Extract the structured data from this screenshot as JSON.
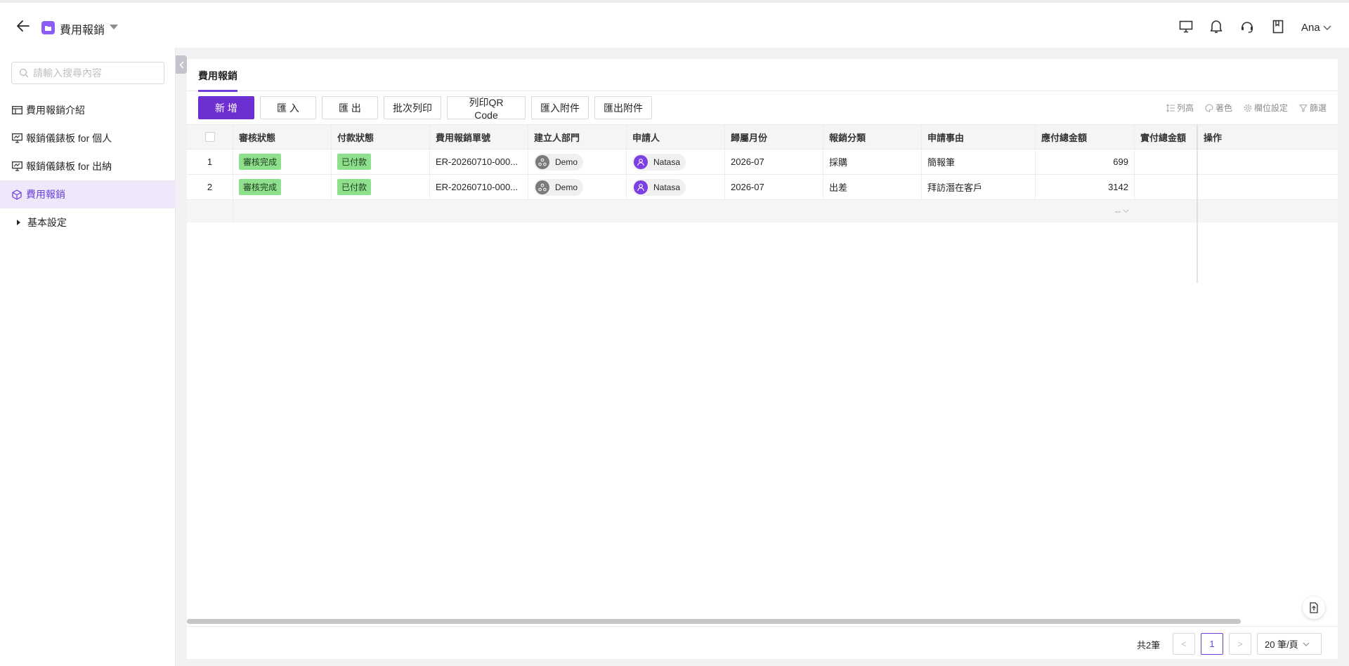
{
  "header": {
    "app_title": "費用報銷",
    "user_name": "Ana"
  },
  "icons": {
    "back": "arrow-left-icon",
    "app": "folder-icon",
    "monitor": "monitor-icon",
    "bell": "bell-icon",
    "headset": "headset-icon",
    "book": "book-icon"
  },
  "colors": {
    "accent": "#6d2fd1",
    "tag_green": "#8ee08c",
    "active_nav_bg": "#efe8fb"
  },
  "sidebar": {
    "search_placeholder": "請輸入搜尋內容",
    "items": [
      {
        "label": "費用報銷介紹",
        "icon": "table-icon"
      },
      {
        "label": "報銷儀錶板 for 個人",
        "icon": "dashboard-icon"
      },
      {
        "label": "報銷儀錶板 for 出納",
        "icon": "dashboard-icon"
      },
      {
        "label": "費用報銷",
        "icon": "cube-icon",
        "active": true
      },
      {
        "label": "基本設定",
        "icon": "caret-right-icon"
      }
    ]
  },
  "main": {
    "tab_label": "費用報銷",
    "toolbar": {
      "add": "新 增",
      "import": "匯 入",
      "export": "匯 出",
      "batch_print": "批次列印",
      "print_qr": "列印QR Code",
      "import_attach": "匯入附件",
      "export_attach": "匯出附件"
    },
    "tools": {
      "row_height": "列高",
      "coloring": "著色",
      "field_settings": "欄位設定",
      "filter": "篩選"
    },
    "table": {
      "columns": [
        "審核狀態",
        "付款狀態",
        "費用報銷單號",
        "建立人部門",
        "申請人",
        "歸屬月份",
        "報銷分類",
        "申請事由",
        "應付總金額",
        "實付總金額",
        "操作"
      ],
      "rows": [
        {
          "idx": "1",
          "review": "審核完成",
          "pay": "已付款",
          "no": "ER-20260710-000...",
          "dept": "Demo",
          "applicant": "Natasa",
          "month": "2026-07",
          "category": "採購",
          "reason": "簡報筆",
          "payable": "699",
          "paid": "",
          "op": ""
        },
        {
          "idx": "2",
          "review": "審核完成",
          "pay": "已付款",
          "no": "ER-20260710-000...",
          "dept": "Demo",
          "applicant": "Natasa",
          "month": "2026-07",
          "category": "出差",
          "reason": "拜訪潛在客戶",
          "payable": "3142",
          "paid": "",
          "op": ""
        }
      ],
      "summary": "--"
    },
    "pager": {
      "total": "共2筆",
      "prev": "<",
      "current": "1",
      "next": ">",
      "page_size": "20 筆/頁"
    }
  }
}
